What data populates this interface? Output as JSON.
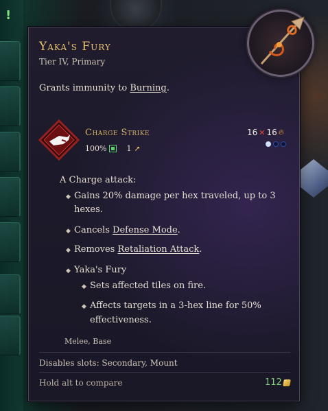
{
  "item": {
    "name": "Yaka's Fury",
    "subtitle": "Tier IV, Primary",
    "description_prefix": "Grants immunity to ",
    "description_link": "Burning",
    "description_suffix": "."
  },
  "ability": {
    "name": "Charge Strike",
    "accuracy": "100%",
    "action_points": "1",
    "damage_physical": "16",
    "damage_fire": "16",
    "pips_filled": 1,
    "pips_total": 3,
    "attack_intro": "A Charge attack:",
    "bullets": [
      "Gains 20% damage per hex traveled, up to 3",
      "hexes."
    ],
    "cancels_prefix": "Cancels ",
    "cancels_link": "Defense Mode",
    "cancels_suffix": ".",
    "removes_prefix": "Removes ",
    "removes_link": "Retaliation Attack",
    "removes_suffix": ".",
    "fury_title": "Yaka's Fury",
    "fury_sub1": "Sets affected tiles on fire.",
    "fury_sub2_line1": "Affects targets in a 3-hex line for 50%",
    "fury_sub2_line2": "effectiveness.",
    "tags": "Melee, Base"
  },
  "footer": {
    "disables": "Disables slots: Secondary, Mount",
    "compare_hint": "Hold alt to compare",
    "price": "112"
  },
  "colors": {
    "title": "#e9c46a",
    "ability_name": "#d6b56a",
    "price": "#7ed07a",
    "panel_bg": "#1c1a2a"
  },
  "icons": [
    "spear-emblem-icon",
    "charge-strike-icon",
    "accuracy-icon",
    "action-point-icon",
    "physical-damage-icon",
    "fire-damage-icon",
    "gold-coin-icon",
    "bullet-icon"
  ]
}
